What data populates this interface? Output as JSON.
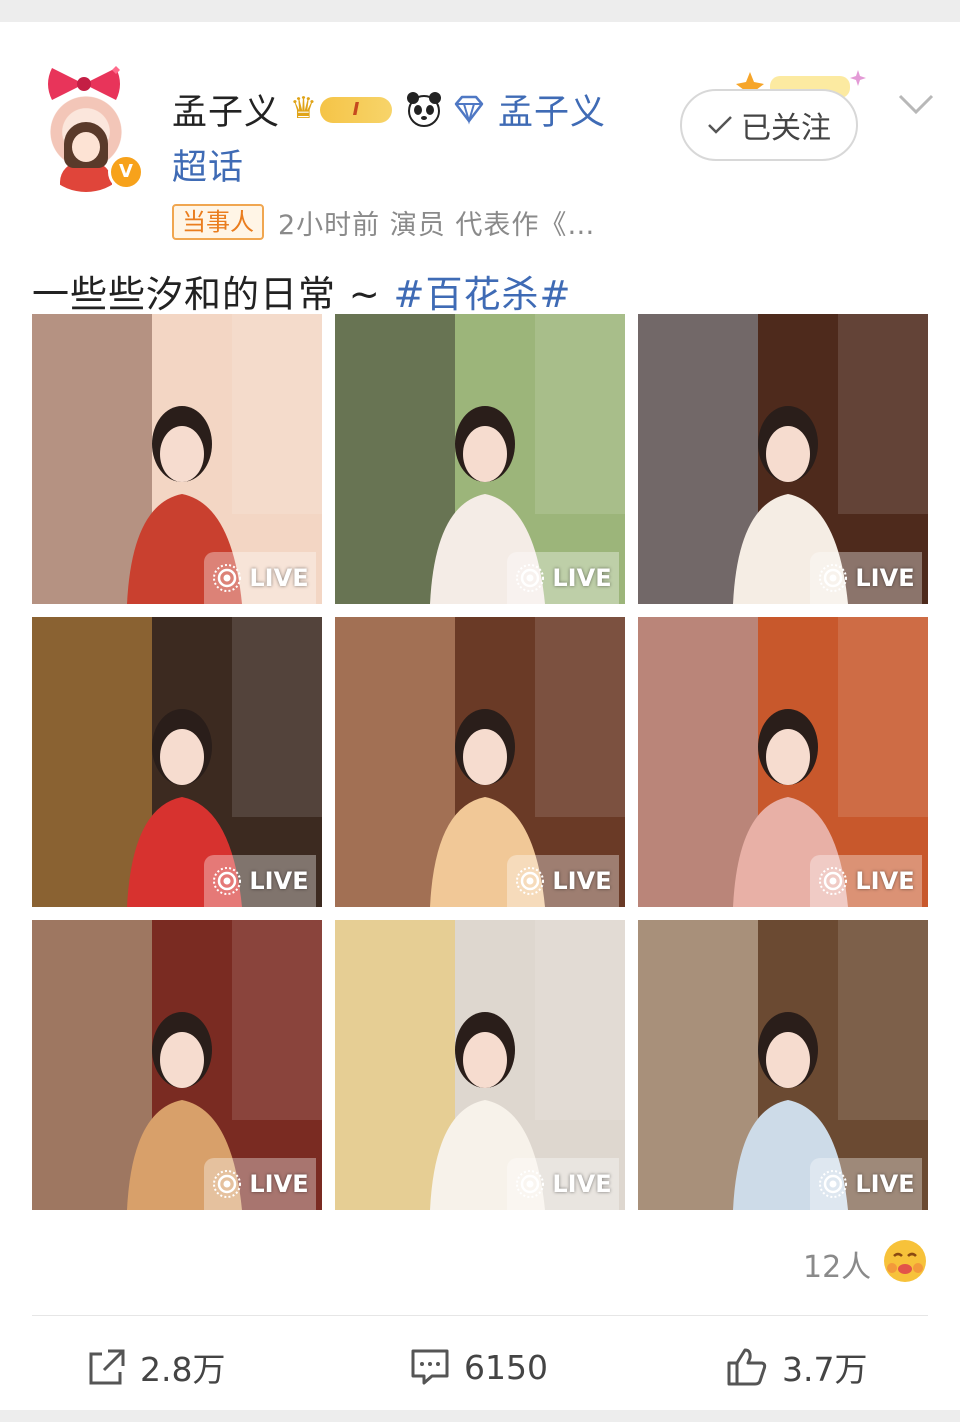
{
  "author": {
    "name": "孟子义",
    "level_badge": "I",
    "topic_link": "孟子义",
    "topic_link_line2": "超话",
    "follow_label": "已关注",
    "party_badge": "当事人",
    "meta": "2小时前  演员 代表作《…",
    "verify_mark": "V"
  },
  "post": {
    "text": "一些些汐和的日常 ~ ",
    "hashtag": "#百花杀#"
  },
  "photos": [
    {
      "live": "LIVE",
      "palette": [
        "#f3d6c4",
        "#c9402f",
        "#6b4034"
      ]
    },
    {
      "live": "LIVE",
      "palette": [
        "#9cb57a",
        "#f4ece6",
        "#2b2523"
      ]
    },
    {
      "live": "LIVE",
      "palette": [
        "#4e2a1c",
        "#f5ede4",
        "#9fb4c5"
      ]
    },
    {
      "live": "LIVE",
      "palette": [
        "#3c2a20",
        "#d7322f",
        "#e9a64a"
      ]
    },
    {
      "live": "LIVE",
      "palette": [
        "#6a3a26",
        "#f1c897",
        "#e7b38f"
      ]
    },
    {
      "live": "LIVE",
      "palette": [
        "#c8582c",
        "#e8b0a6",
        "#a9bdd6"
      ]
    },
    {
      "live": "LIVE",
      "palette": [
        "#7a2b22",
        "#d8a06a",
        "#c9d5b0"
      ]
    },
    {
      "live": "LIVE",
      "palette": [
        "#ded7cf",
        "#f7f2ea",
        "#f0c34c"
      ]
    },
    {
      "live": "LIVE",
      "palette": [
        "#6b4a32",
        "#cddbe8",
        "#f3e6d2"
      ]
    }
  ],
  "reactions": {
    "likers": "12人"
  },
  "actions": {
    "repost": "2.8万",
    "comment": "6150",
    "like": "3.7万"
  },
  "colors": {
    "link": "#3f6bb5",
    "badge_orange": "#ea7d1e",
    "gray_text": "#8a8a8a"
  },
  "icons": [
    "crown-icon",
    "panda-icon",
    "diamond-icon",
    "check-icon",
    "chevron-down-icon",
    "live-icon",
    "hug-emoji-icon",
    "repost-icon",
    "comment-icon",
    "like-icon"
  ]
}
